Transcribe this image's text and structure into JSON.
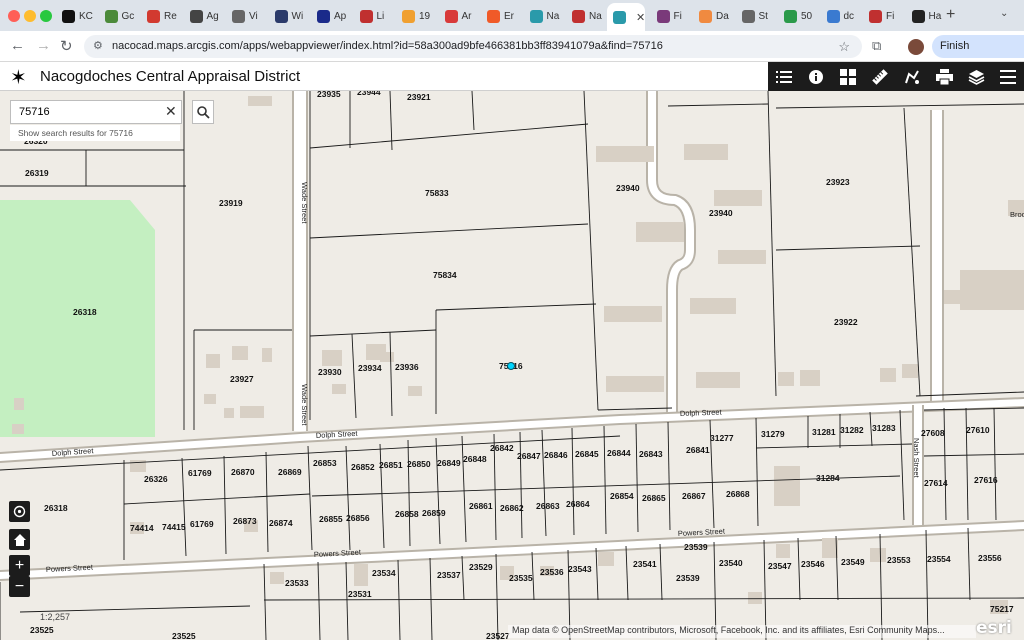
{
  "browser": {
    "tabs": [
      {
        "label": "KC",
        "color": "#111111"
      },
      {
        "label": "Gc",
        "color": "#4b8a3a"
      },
      {
        "label": "Re",
        "color": "#d23a30"
      },
      {
        "label": "Ag",
        "color": "#444444"
      },
      {
        "label": "Vi",
        "color": "#666666"
      },
      {
        "label": "Wi",
        "color": "#2a3a6a"
      },
      {
        "label": "Ap",
        "color": "#1a2a8a"
      },
      {
        "label": "Li",
        "color": "#c03030"
      },
      {
        "label": "19",
        "color": "#f0a030"
      },
      {
        "label": "Ar",
        "color": "#d83a3a"
      },
      {
        "label": "Er",
        "color": "#f05a28"
      },
      {
        "label": "Na",
        "color": "#2a9aaa"
      },
      {
        "label": "Na",
        "color": "#c03030"
      },
      {
        "label": "Fi",
        "color": "#7a3a7a"
      },
      {
        "label": "Da",
        "color": "#f08a40"
      },
      {
        "label": "St",
        "color": "#666666"
      },
      {
        "label": "50",
        "color": "#2a9a4a"
      },
      {
        "label": "dc",
        "color": "#3a7ad0"
      },
      {
        "label": "Fi",
        "color": "#c03030"
      },
      {
        "label": "Ha",
        "color": "#222222"
      }
    ],
    "active_tab_color": "#2a9aaa",
    "url": "nacocad.maps.arcgis.com/apps/webappviewer/index.html?id=58a300ad9bfe466381bb3ff83941079a&find=75716",
    "finish_update_label": "Finish update"
  },
  "app": {
    "title": "Nacogdoches Central Appraisal District",
    "widget_icons": [
      "legend-list-icon",
      "info-icon",
      "basemap-gallery-icon",
      "measure-ruler-icon",
      "draw-icon",
      "print-icon",
      "layers-icon",
      "menu-icon"
    ]
  },
  "search": {
    "value": "75716",
    "suggestion": "Show search results for 75716"
  },
  "map": {
    "scale_label": "1:2,257",
    "attribution": "Map data © OpenStreetMap contributors, Microsoft, Facebook, Inc. and its affiliates, Esri Community Maps...",
    "esri_logo": "esri",
    "parcel_labels": [
      {
        "id": "p1",
        "text": "23935"
      },
      {
        "id": "p2",
        "text": "23944"
      },
      {
        "id": "p3",
        "text": "23921"
      },
      {
        "id": "p4",
        "text": "26320"
      },
      {
        "id": "p5",
        "text": "26319"
      },
      {
        "id": "p6",
        "text": "23919"
      },
      {
        "id": "p7",
        "text": "75833"
      },
      {
        "id": "p8",
        "text": "23940"
      },
      {
        "id": "p9",
        "text": "23940"
      },
      {
        "id": "p10",
        "text": "23923"
      },
      {
        "id": "p11",
        "text": "75834"
      },
      {
        "id": "p12",
        "text": "26318"
      },
      {
        "id": "p13",
        "text": "23922"
      },
      {
        "id": "p14",
        "text": "23930"
      },
      {
        "id": "p15",
        "text": "23934"
      },
      {
        "id": "p16",
        "text": "23936"
      },
      {
        "id": "p17",
        "text": "75716"
      },
      {
        "id": "p18",
        "text": "23927"
      },
      {
        "id": "p19",
        "text": "27608"
      },
      {
        "id": "p20",
        "text": "27610"
      },
      {
        "id": "p21",
        "text": "31277"
      },
      {
        "id": "p22",
        "text": "31279"
      },
      {
        "id": "p23",
        "text": "31281"
      },
      {
        "id": "p24",
        "text": "31282"
      },
      {
        "id": "p25",
        "text": "31283"
      },
      {
        "id": "p26",
        "text": "26842"
      },
      {
        "id": "p27",
        "text": "26841"
      },
      {
        "id": "p28",
        "text": "26853"
      },
      {
        "id": "p29",
        "text": "26852"
      },
      {
        "id": "p30",
        "text": "26851"
      },
      {
        "id": "p31",
        "text": "26850"
      },
      {
        "id": "p32",
        "text": "26849"
      },
      {
        "id": "p33",
        "text": "26848"
      },
      {
        "id": "p34",
        "text": "26847"
      },
      {
        "id": "p35",
        "text": "26846"
      },
      {
        "id": "p36",
        "text": "26845"
      },
      {
        "id": "p37",
        "text": "26844"
      },
      {
        "id": "p38",
        "text": "26843"
      },
      {
        "id": "p39",
        "text": "26326"
      },
      {
        "id": "p40",
        "text": "61769"
      },
      {
        "id": "p41",
        "text": "26870"
      },
      {
        "id": "p42",
        "text": "26869"
      },
      {
        "id": "p43",
        "text": "31284"
      },
      {
        "id": "p44",
        "text": "27614"
      },
      {
        "id": "p45",
        "text": "27616"
      },
      {
        "id": "p46",
        "text": "26318"
      },
      {
        "id": "p47",
        "text": "26854"
      },
      {
        "id": "p48",
        "text": "26865"
      },
      {
        "id": "p49",
        "text": "26867"
      },
      {
        "id": "p50",
        "text": "26868"
      },
      {
        "id": "p51",
        "text": "26861"
      },
      {
        "id": "p52",
        "text": "26862"
      },
      {
        "id": "p53",
        "text": "26863"
      },
      {
        "id": "p54",
        "text": "26864"
      },
      {
        "id": "p55",
        "text": "26858"
      },
      {
        "id": "p56",
        "text": "26859"
      },
      {
        "id": "p57",
        "text": "74414"
      },
      {
        "id": "p58",
        "text": "74415"
      },
      {
        "id": "p59",
        "text": "61769"
      },
      {
        "id": "p60",
        "text": "26873"
      },
      {
        "id": "p61",
        "text": "26874"
      },
      {
        "id": "p62",
        "text": "26855"
      },
      {
        "id": "p63",
        "text": "26856"
      },
      {
        "id": "p64",
        "text": "23539"
      },
      {
        "id": "p65",
        "text": "23540"
      },
      {
        "id": "p66",
        "text": "23547"
      },
      {
        "id": "p67",
        "text": "23546"
      },
      {
        "id": "p68",
        "text": "23549"
      },
      {
        "id": "p69",
        "text": "23553"
      },
      {
        "id": "p70",
        "text": "23554"
      },
      {
        "id": "p71",
        "text": "23556"
      },
      {
        "id": "p72",
        "text": "23533"
      },
      {
        "id": "p73",
        "text": "23534"
      },
      {
        "id": "p74",
        "text": "23537"
      },
      {
        "id": "p75",
        "text": "23529"
      },
      {
        "id": "p76",
        "text": "23535"
      },
      {
        "id": "p77",
        "text": "23536"
      },
      {
        "id": "p78",
        "text": "23543"
      },
      {
        "id": "p79",
        "text": "23541"
      },
      {
        "id": "p80",
        "text": "23539"
      },
      {
        "id": "p81",
        "text": "23531"
      },
      {
        "id": "p82",
        "text": "23525"
      },
      {
        "id": "p83",
        "text": "23525"
      },
      {
        "id": "p84",
        "text": "23527"
      },
      {
        "id": "p85",
        "text": "75217"
      }
    ],
    "street_labels": {
      "wade_upper": "Wade Street",
      "wade_lower": "Wade Street",
      "dolph_left": "Dolph Street",
      "dolph_mid": "Dolph Street",
      "dolph_right": "Dolph Street",
      "nash": "Nash Street",
      "powers_left": "Powers Street",
      "powers_mid": "Powers Street",
      "powers_right": "Powers Street",
      "brook_partial": "Broo"
    },
    "colors": {
      "background": "#efece6",
      "park": "#c4efc1",
      "building": "#d8d0c5",
      "road_fill": "#ffffff",
      "road_edge": "#b9b3a8",
      "parcel_line": "#1a1a1a",
      "selection": "#00d5ff"
    }
  }
}
